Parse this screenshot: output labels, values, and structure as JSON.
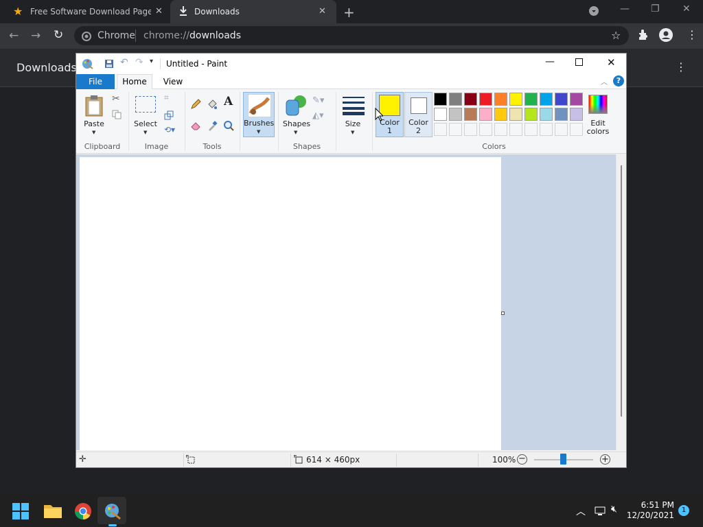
{
  "browser": {
    "tabs": [
      {
        "title": "Free Software Download Page -",
        "active": false
      },
      {
        "title": "Downloads",
        "active": true
      }
    ],
    "omnibox": {
      "site": "Chrome",
      "url_prefix": "chrome://",
      "url_path": "downloads"
    }
  },
  "downloads_page": {
    "title": "Downloads"
  },
  "paint": {
    "window_title": "Untitled - Paint",
    "tabs": {
      "file": "File",
      "home": "Home",
      "view": "View"
    },
    "ribbon": {
      "paste": "Paste",
      "select": "Select",
      "brushes": "Brushes",
      "shapes": "Shapes",
      "size": "Size",
      "color1": "Color\n1",
      "color1_line1": "Color",
      "color1_line2": "1",
      "color2_line1": "Color",
      "color2_line2": "2",
      "edit_colors_line1": "Edit",
      "edit_colors_line2": "colors",
      "groups": {
        "clipboard": "Clipboard",
        "image": "Image",
        "tools": "Tools",
        "shapes": "Shapes",
        "colors": "Colors"
      }
    },
    "current_colors": {
      "color1": "#fff200",
      "color2": "#ffffff"
    },
    "palette_row1": [
      "#000000",
      "#7f7f7f",
      "#880015",
      "#ed1c24",
      "#ff7f27",
      "#fff200",
      "#22b14c",
      "#00a2e8",
      "#3f48cc",
      "#a349a4"
    ],
    "palette_row2": [
      "#ffffff",
      "#c3c3c3",
      "#b97a57",
      "#ffaec9",
      "#ffc90e",
      "#efe4b0",
      "#b5e61d",
      "#99d9ea",
      "#7092be",
      "#c8bfe7"
    ],
    "status": {
      "canvas_size": "614 × 460px",
      "zoom": "100%"
    }
  },
  "taskbar": {
    "time": "6:51 PM",
    "date": "12/20/2021",
    "notifications": "1"
  }
}
